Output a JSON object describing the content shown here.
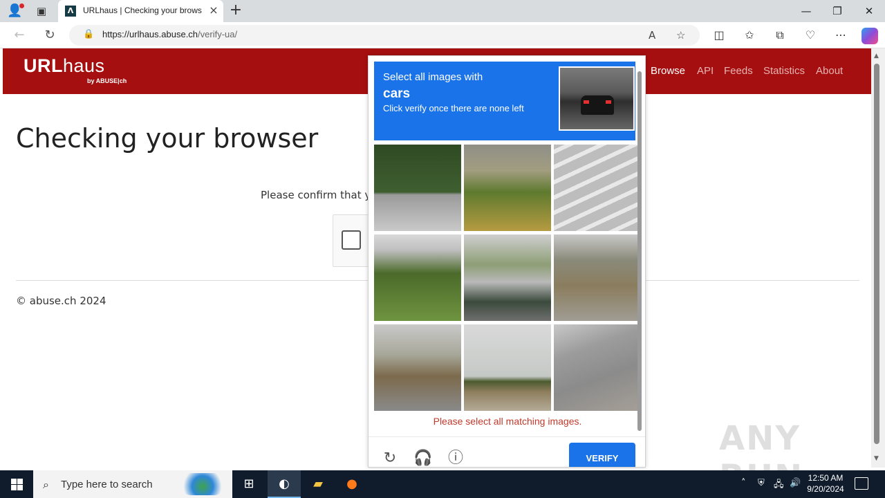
{
  "browser": {
    "tab_title": "URLhaus | Checking your browser",
    "url_host": "https://urlhaus.abuse.ch",
    "url_path": "/verify-ua/",
    "favicon_letter": "Λ",
    "new_tab": "+",
    "minimize": "—",
    "restore": "❐",
    "close": "✕"
  },
  "site": {
    "logo_main": "URL",
    "logo_light": "haus",
    "logo_sub": "by ABUSE|ch",
    "nav": [
      "Browse",
      "API",
      "Feeds",
      "Statistics",
      "About"
    ],
    "active_nav": "Browse",
    "heading": "Checking your browser",
    "confirm_text": "Please confirm that yo",
    "copyright": "© abuse.ch 2024"
  },
  "challenge": {
    "line1": "Select all images with",
    "target": "cars",
    "line3": "Click verify once there are none left",
    "error": "Please select all matching images.",
    "verify_label": "VERIFY",
    "tiles": [
      "bushes-parking-lot",
      "shrubs-sign",
      "parking-lines",
      "grassy-hill",
      "palm-building",
      "railroad-tracks",
      "street-palm-trees",
      "field-horizon",
      "guardrail-road"
    ]
  },
  "watermark": "ANY RUN",
  "taskbar": {
    "search_placeholder": "Type here to search",
    "time": "12:50 AM",
    "date": "9/20/2024"
  }
}
